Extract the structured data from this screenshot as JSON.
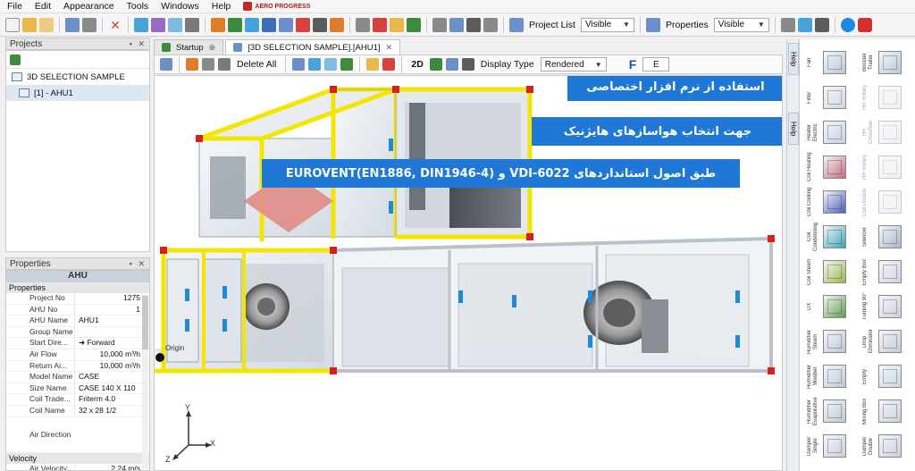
{
  "menu": [
    "File",
    "Edit",
    "Appearance",
    "Tools",
    "Windows",
    "Help"
  ],
  "logo_text": "AERO PROGRESS",
  "toolbar": {
    "project_list_label": "Project List",
    "project_list_value": "Visible",
    "properties_label": "Properties",
    "properties_value": "Visible",
    "icon_colors": [
      "#e9b84a",
      "#6c8fc7",
      "#d94040",
      "#3d8c3d",
      "#9a6bc2",
      "#4aa3d8",
      "#e07b2a",
      "#5c5c5c"
    ]
  },
  "projects_panel": {
    "title": "Projects",
    "tree": [
      {
        "label": "3D SELECTION SAMPLE",
        "selected": false
      },
      {
        "label": "[1] - AHU1",
        "selected": true
      }
    ]
  },
  "properties_panel": {
    "title": "Properties",
    "header": "AHU",
    "categories": [
      {
        "name": "Properties",
        "rows": [
          {
            "key": "Project No",
            "value": "1275"
          },
          {
            "key": "AHU No",
            "value": "1"
          },
          {
            "key": "AHU Name",
            "value": "AHU1"
          },
          {
            "key": "Group Name",
            "value": ""
          },
          {
            "key": "Start Dire...",
            "value": "Forward"
          },
          {
            "key": "Air Flow",
            "value": "10,000 m³/h"
          },
          {
            "key": "Return Ai...",
            "value": "10,000 m³/h"
          },
          {
            "key": "Model Name",
            "value": "CASE"
          },
          {
            "key": "Size Name",
            "value": "CASE 140 X 110"
          },
          {
            "key": "Coil Trade...",
            "value": "Friterm 4.0"
          },
          {
            "key": "Coil Name",
            "value": "32 x 28 1/2"
          },
          {
            "key": "Air Direction",
            "value": ""
          }
        ]
      },
      {
        "name": "Velocity",
        "rows": [
          {
            "key": "Air Velocity",
            "value": "2.24 m/s"
          }
        ]
      }
    ]
  },
  "tabs": [
    {
      "label": "Startup",
      "active": false
    },
    {
      "label": "[3D SELECTION SAMPLE].[AHU1]",
      "active": true
    }
  ],
  "view_toolbar": {
    "delete_all": "Delete All",
    "mode_2d": "2D",
    "display_type_label": "Display Type",
    "display_type_value": "Rendered",
    "letter_f": "F",
    "letter_e": "E"
  },
  "viewport": {
    "origin_label": "Origin",
    "axis_x": "X",
    "axis_y": "Y",
    "axis_z": "Z",
    "banners": [
      "استفاده از نرم افزار اختصاصی",
      "جهت انتخاب هواسازهای هایژنیک",
      "طبق اصول استانداردهای VDI-6022 و EUROVENT(EN1886, DIN1946-4)"
    ],
    "banner_color": "#1f77d6",
    "frame_yellow": "#f3e600",
    "frame_red": "#d62020",
    "panel_blue": "#1f8ad6"
  },
  "palette": {
    "help_tabs": [
      "Help",
      "Help"
    ],
    "items": [
      {
        "label": "Fan",
        "color": "#b9c7d8",
        "faded": false
      },
      {
        "label": "Booster Trailer",
        "color": "#b9c7d8",
        "faded": false
      },
      {
        "label": "Filter",
        "color": "#cfd8e3",
        "faded": false
      },
      {
        "label": "HR Rotary",
        "color": "#d9dee5",
        "faded": true
      },
      {
        "label": "Heater Electric",
        "color": "#c3d1e2",
        "faded": false
      },
      {
        "label": "HR Crossflow",
        "color": "#d9dee5",
        "faded": true
      },
      {
        "label": "Coil Heating",
        "color": "#c06e79",
        "faded": false
      },
      {
        "label": "HR Rotary",
        "color": "#d9dee5",
        "faded": true
      },
      {
        "label": "Coil Cooling",
        "color": "#4d5fb8",
        "faded": false
      },
      {
        "label": "Coil Double",
        "color": "#d9dee5",
        "faded": true
      },
      {
        "label": "Coil Condensing",
        "color": "#3aa5b8",
        "faded": false
      },
      {
        "label": "Silencer",
        "color": "#a9b6c9",
        "faded": false
      },
      {
        "label": "Coil Steam",
        "color": "#9ab84f",
        "faded": false
      },
      {
        "label": "Empty Box",
        "color": "#cdd6e2",
        "faded": false
      },
      {
        "label": "DX",
        "color": "#5f9f4a",
        "faded": false
      },
      {
        "label": "Turning 90°",
        "color": "#c9d0da",
        "faded": false
      },
      {
        "label": "Humidifier Steam",
        "color": "#bcc7d6",
        "faded": false
      },
      {
        "label": "Drop Eliminator",
        "color": "#c3cbd6",
        "faded": false
      },
      {
        "label": "Humidifier Washer",
        "color": "#bcc7d6",
        "faded": false
      },
      {
        "label": "Empty",
        "color": "#cdd6e2",
        "faded": false
      },
      {
        "label": "Humidifier Evaporative",
        "color": "#bcc7d6",
        "faded": false
      },
      {
        "label": "Mixing Box",
        "color": "#c9d0da",
        "faded": false
      },
      {
        "label": "Damper Single",
        "color": "#c9d0da",
        "faded": false
      },
      {
        "label": "Damper Double",
        "color": "#c9d0da",
        "faded": false
      }
    ]
  }
}
